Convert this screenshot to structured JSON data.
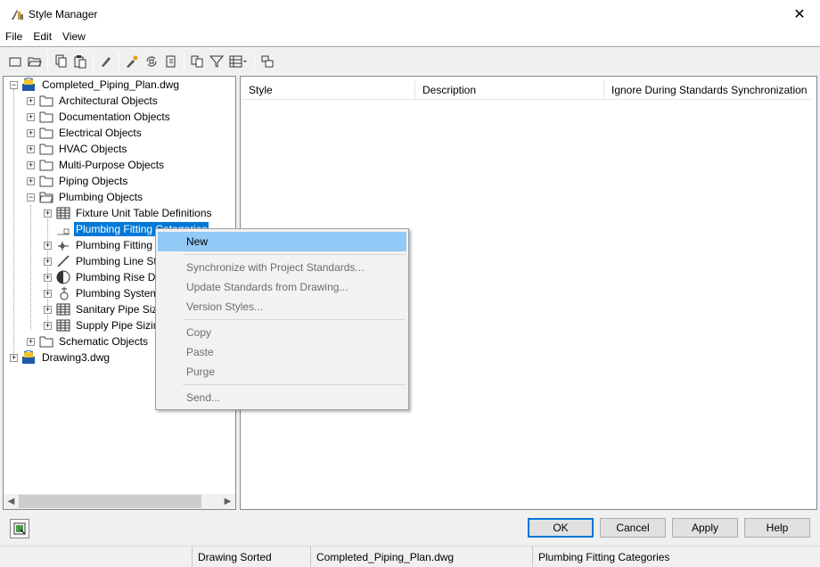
{
  "window": {
    "title": "Style Manager",
    "close_glyph": "✕"
  },
  "menu": [
    "File",
    "Edit",
    "View"
  ],
  "toolbar_icons": [
    "new-drawing-icon",
    "open-drawing-icon",
    "copy-icon",
    "paste-icon",
    "edit-style-icon",
    "purge-icon",
    "sync-icon",
    "update-icon",
    "sort-icon",
    "filter-icon",
    "view-mode-icon",
    "toggle-view-icon"
  ],
  "tree": {
    "root1": "Completed_Piping_Plan.dwg",
    "items": [
      "Architectural Objects",
      "Documentation Objects",
      "Electrical Objects",
      "HVAC Objects",
      "Multi-Purpose Objects",
      "Piping Objects",
      "Plumbing Objects"
    ],
    "plumbing_children": [
      "Fixture Unit Table Definitions",
      "Plumbing Fitting Categories",
      "Plumbing Fitting",
      "Plumbing Line St",
      "Plumbing Rise Dr",
      "Plumbing System",
      "Sanitary Pipe Sizin",
      "Supply Pipe Sizin"
    ],
    "after": "Schematic Objects",
    "root2": "Drawing3.dwg"
  },
  "list": {
    "columns": [
      "Style",
      "Description",
      "Ignore During Standards Synchronization"
    ]
  },
  "context_menu": {
    "items": [
      {
        "label": "New",
        "enabled": true,
        "highlight": true
      },
      {
        "label": "Synchronize with Project Standards...",
        "enabled": false
      },
      {
        "label": "Update Standards from Drawing...",
        "enabled": false
      },
      {
        "label": "Version Styles...",
        "enabled": false
      },
      {
        "label": "Copy",
        "enabled": false
      },
      {
        "label": "Paste",
        "enabled": false
      },
      {
        "label": "Purge",
        "enabled": false
      },
      {
        "label": "Send...",
        "enabled": false
      }
    ]
  },
  "buttons": {
    "ok": "OK",
    "cancel": "Cancel",
    "apply": "Apply",
    "help": "Help"
  },
  "status": {
    "sort": "Drawing Sorted",
    "file": "Completed_Piping_Plan.dwg",
    "category": "Plumbing Fitting Categories"
  },
  "colors": {
    "selection": "#0078d7",
    "menu_highlight": "#91c9f7"
  }
}
